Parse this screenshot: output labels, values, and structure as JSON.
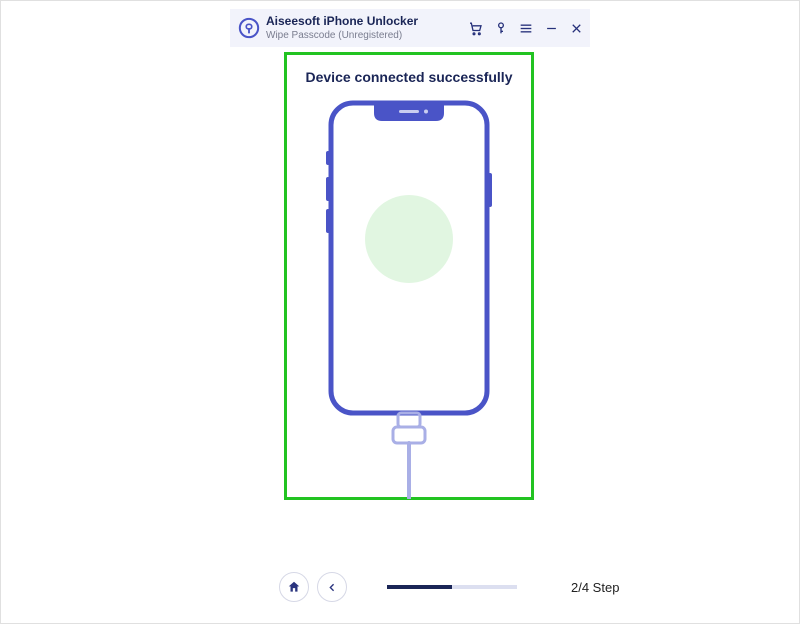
{
  "titlebar": {
    "app_title": "Aiseesoft iPhone Unlocker",
    "subtitle": "Wipe Passcode  (Unregistered)"
  },
  "main": {
    "status_heading": "Device connected successfully"
  },
  "footer": {
    "step_label": "2/4 Step",
    "progress_current": 2,
    "progress_total": 4
  },
  "colors": {
    "brand": "#4a54c7",
    "dark_navy": "#1a2556",
    "highlight_border": "#22c321",
    "success_fill": "#e1f6e1"
  }
}
